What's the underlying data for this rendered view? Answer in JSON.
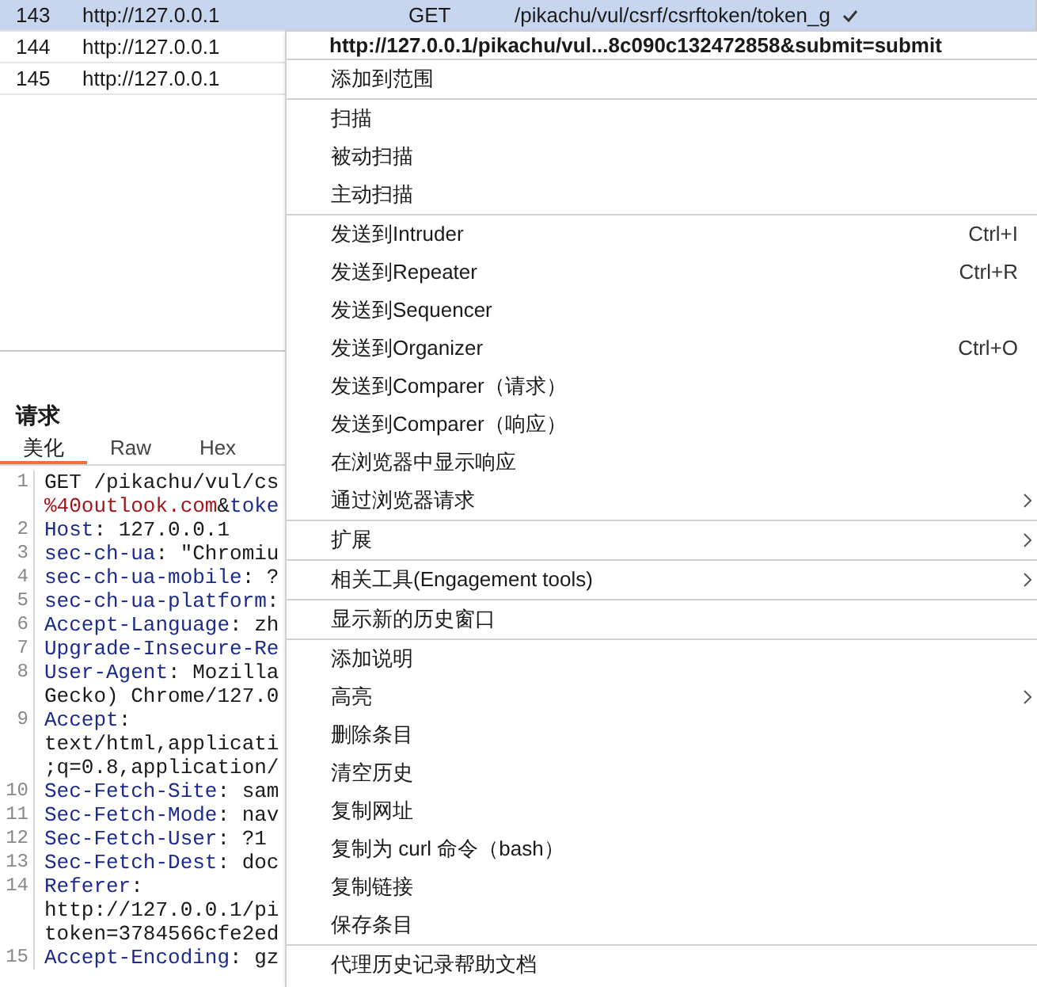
{
  "history_table": {
    "rows": [
      {
        "number": "143",
        "host": "http://127.0.0.1",
        "method": "GET",
        "path": "/pikachu/vul/csrf/csrftoken/token_g",
        "selected": true
      },
      {
        "number": "144",
        "host": "http://127.0.0.1",
        "selected": false
      },
      {
        "number": "145",
        "host": "http://127.0.0.1",
        "selected": false
      }
    ]
  },
  "request_panel": {
    "title": "请求",
    "tabs": [
      {
        "label": "美化",
        "selected": true
      },
      {
        "label": "Raw",
        "selected": false
      },
      {
        "label": "Hex",
        "selected": false
      }
    ],
    "lines": [
      {
        "number": "1",
        "rows": [
          [
            {
              "kind": "plain",
              "text": "GET /pikachu/vul/cs"
            }
          ],
          [
            {
              "kind": "param",
              "text": "%40outlook.com"
            },
            {
              "kind": "plain",
              "text": "&"
            },
            {
              "kind": "key",
              "text": "toke"
            }
          ]
        ]
      },
      {
        "number": "2",
        "rows": [
          [
            {
              "kind": "key",
              "text": "Host"
            },
            {
              "kind": "plain",
              "text": ": 127.0.0.1"
            }
          ]
        ]
      },
      {
        "number": "3",
        "rows": [
          [
            {
              "kind": "key",
              "text": "sec-ch-ua"
            },
            {
              "kind": "plain",
              "text": ": \"Chromiu"
            }
          ]
        ]
      },
      {
        "number": "4",
        "rows": [
          [
            {
              "kind": "key",
              "text": "sec-ch-ua-mobile"
            },
            {
              "kind": "plain",
              "text": ": ?"
            }
          ]
        ]
      },
      {
        "number": "5",
        "rows": [
          [
            {
              "kind": "key",
              "text": "sec-ch-ua-platform"
            },
            {
              "kind": "plain",
              "text": ":"
            }
          ]
        ]
      },
      {
        "number": "6",
        "rows": [
          [
            {
              "kind": "key",
              "text": "Accept-Language"
            },
            {
              "kind": "plain",
              "text": ": zh"
            }
          ]
        ]
      },
      {
        "number": "7",
        "rows": [
          [
            {
              "kind": "key",
              "text": "Upgrade-Insecure-Re"
            }
          ]
        ]
      },
      {
        "number": "8",
        "rows": [
          [
            {
              "kind": "key",
              "text": "User-Agent"
            },
            {
              "kind": "plain",
              "text": ": Mozilla"
            }
          ],
          [
            {
              "kind": "plain",
              "text": "Gecko) Chrome/127.0"
            }
          ]
        ]
      },
      {
        "number": "9",
        "rows": [
          [
            {
              "kind": "key",
              "text": "Accept"
            },
            {
              "kind": "plain",
              "text": ":"
            }
          ],
          [
            {
              "kind": "plain",
              "text": "text/html,applicati"
            }
          ],
          [
            {
              "kind": "plain",
              "text": ";q=0.8,application/"
            }
          ]
        ]
      },
      {
        "number": "10",
        "rows": [
          [
            {
              "kind": "key",
              "text": "Sec-Fetch-Site"
            },
            {
              "kind": "plain",
              "text": ": sam"
            }
          ]
        ]
      },
      {
        "number": "11",
        "rows": [
          [
            {
              "kind": "key",
              "text": "Sec-Fetch-Mode"
            },
            {
              "kind": "plain",
              "text": ": nav"
            }
          ]
        ]
      },
      {
        "number": "12",
        "rows": [
          [
            {
              "kind": "key",
              "text": "Sec-Fetch-User"
            },
            {
              "kind": "plain",
              "text": ": ?1"
            }
          ]
        ]
      },
      {
        "number": "13",
        "rows": [
          [
            {
              "kind": "key",
              "text": "Sec-Fetch-Dest"
            },
            {
              "kind": "plain",
              "text": ": doc"
            }
          ]
        ]
      },
      {
        "number": "14",
        "rows": [
          [
            {
              "kind": "key",
              "text": "Referer"
            },
            {
              "kind": "plain",
              "text": ":"
            }
          ],
          [
            {
              "kind": "plain",
              "text": "http://127.0.0.1/pi"
            }
          ],
          [
            {
              "kind": "plain",
              "text": "token=3784566cfe2ed"
            }
          ]
        ]
      },
      {
        "number": "15",
        "rows": [
          [
            {
              "kind": "key",
              "text": "Accept-Encoding"
            },
            {
              "kind": "plain",
              "text": ": gz"
            }
          ]
        ]
      }
    ]
  },
  "context_menu": {
    "header": "http://127.0.0.1/pikachu/vul...8c090c132472858&submit=submit",
    "groups": [
      [
        {
          "label": "添加到范围",
          "has_submenu": false
        }
      ],
      [
        {
          "label": "扫描",
          "has_submenu": false
        },
        {
          "label": "被动扫描",
          "has_submenu": false
        },
        {
          "label": "主动扫描",
          "has_submenu": false
        }
      ],
      [
        {
          "label": "发送到Intruder",
          "shortcut": "Ctrl+I",
          "has_submenu": false
        },
        {
          "label": "发送到Repeater",
          "shortcut": "Ctrl+R",
          "has_submenu": false
        },
        {
          "label": "发送到Sequencer",
          "has_submenu": false
        },
        {
          "label": "发送到Organizer",
          "shortcut": "Ctrl+O",
          "has_submenu": false
        },
        {
          "label": "发送到Comparer（请求）",
          "has_submenu": false
        },
        {
          "label": "发送到Comparer（响应）",
          "has_submenu": false
        },
        {
          "label": "在浏览器中显示响应",
          "has_submenu": false
        },
        {
          "label": "通过浏览器请求",
          "has_submenu": true
        }
      ],
      [
        {
          "label": "扩展",
          "has_submenu": true
        }
      ],
      [
        {
          "label": "相关工具(Engagement tools)",
          "has_submenu": true
        }
      ],
      [
        {
          "label": "显示新的历史窗口",
          "has_submenu": false
        }
      ],
      [
        {
          "label": "添加说明",
          "has_submenu": false
        },
        {
          "label": "高亮",
          "has_submenu": true
        },
        {
          "label": "删除条目",
          "has_submenu": false
        },
        {
          "label": "清空历史",
          "has_submenu": false
        },
        {
          "label": "复制网址",
          "has_submenu": false
        },
        {
          "label": "复制为 curl 命令（bash）",
          "has_submenu": false
        },
        {
          "label": "复制链接",
          "has_submenu": false
        },
        {
          "label": "保存条目",
          "has_submenu": false
        }
      ],
      [
        {
          "label": "代理历史记录帮助文档",
          "has_submenu": false
        }
      ]
    ]
  }
}
